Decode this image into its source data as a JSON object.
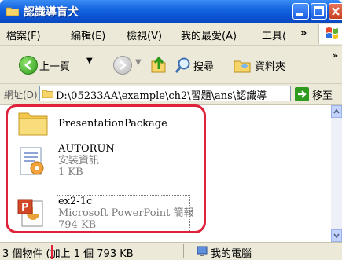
{
  "window": {
    "title": "認識導盲犬"
  },
  "menu": [
    "檔案(F)",
    "編輯(E)",
    "檢視(V)",
    "我的最愛(A)",
    "工具(",
    "»"
  ],
  "toolbar": {
    "back_label": "上一頁",
    "search_label": "搜尋",
    "folders_label": "資料夾",
    "more": "»"
  },
  "address": {
    "label": "網址(D)",
    "value": "D:\\05233AA\\example\\ch2\\習題\\ans\\認識導",
    "go_label": "移至"
  },
  "files": [
    {
      "name": "PresentationPackage",
      "type": "",
      "size": "",
      "icon": "folder-icon"
    },
    {
      "name": "AUTORUN",
      "type": "安裝資訊",
      "size": "1 KB",
      "icon": "setup-info-icon"
    },
    {
      "name": "ex2-1c",
      "type": "Microsoft PowerPoint 簡報",
      "size": "794 KB",
      "icon": "powerpoint-icon"
    }
  ],
  "status": {
    "summary": "3 個物件 (加上 1 個 793 KB",
    "location": "我的電腦"
  },
  "colors": {
    "highlight": "#e0213a",
    "titlebar": "#0b55d4"
  }
}
